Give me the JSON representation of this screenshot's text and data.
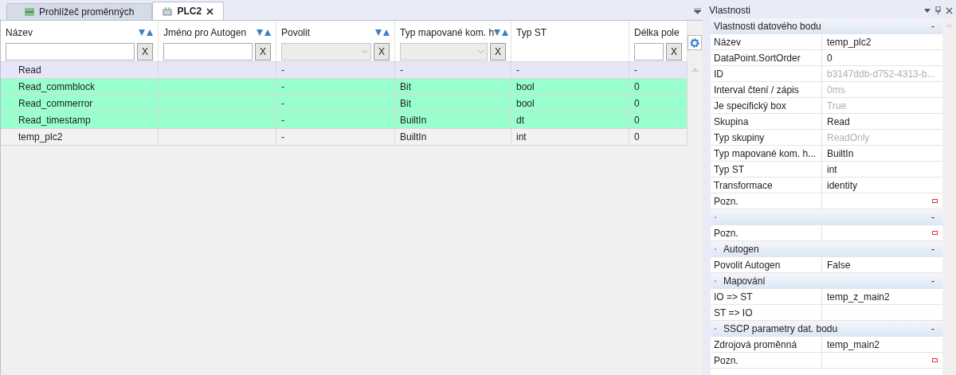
{
  "tabs": [
    {
      "label": "Prohlížeč proměnných",
      "selected": false,
      "closable": false
    },
    {
      "label": "PLC2",
      "selected": true,
      "closable": true
    }
  ],
  "grid": {
    "columns": [
      {
        "label": "Název",
        "sortable": true,
        "filter": {
          "kind": "text",
          "clear": "X"
        }
      },
      {
        "label": "Jméno pro Autogen",
        "sortable": true,
        "filter": {
          "kind": "text",
          "clear": "X"
        }
      },
      {
        "label": "Povolit",
        "sortable": true,
        "filter": {
          "kind": "select",
          "clear": "X"
        }
      },
      {
        "label": "Typ mapované kom. h",
        "sortable": true,
        "filter": {
          "kind": "select",
          "clear": "X"
        }
      },
      {
        "label": "Typ ST",
        "sortable": false
      },
      {
        "label": "Délka pole",
        "sortable": false,
        "filter": {
          "kind": "text",
          "clear": "X"
        }
      }
    ],
    "rows": [
      {
        "kind": "group",
        "cells": [
          "Read",
          "",
          "-",
          "-",
          "-",
          "-"
        ]
      },
      {
        "kind": "highlighted",
        "cells": [
          "Read_commblock",
          "",
          "-",
          "Bit",
          "bool",
          "0"
        ]
      },
      {
        "kind": "highlighted",
        "cells": [
          "Read_commerror",
          "",
          "-",
          "Bit",
          "bool",
          "0"
        ]
      },
      {
        "kind": "highlighted",
        "cells": [
          "Read_timestamp",
          "",
          "-",
          "BuiltIn",
          "dt",
          "0"
        ]
      },
      {
        "kind": "plain",
        "cells": [
          "temp_plc2",
          "",
          "-",
          "BuiltIn",
          "int",
          "0"
        ]
      }
    ]
  },
  "properties": {
    "title": "Vlastnosti",
    "sections": [
      {
        "bullet": false,
        "title": "Vlastnosti datového bodu",
        "collapse": "-",
        "rows": [
          {
            "name": "Název",
            "value": "temp_plc2",
            "disabled": false,
            "note": false
          },
          {
            "name": "DataPoint.SortOrder",
            "value": "0",
            "disabled": false,
            "note": false
          },
          {
            "name": "ID",
            "value": "b3147ddb-d752-4313-b...",
            "disabled": true,
            "note": false
          },
          {
            "name": "Interval čtení / zápis",
            "value": "0ms",
            "disabled": true,
            "note": false
          },
          {
            "name": "Je specifický box",
            "value": "True",
            "disabled": true,
            "note": false
          },
          {
            "name": "Skupina",
            "value": "Read",
            "disabled": false,
            "note": false
          },
          {
            "name": "Typ skupiny",
            "value": "ReadOnly",
            "disabled": true,
            "note": false
          },
          {
            "name": "Typ mapované kom. h...",
            "value": "BuiltIn",
            "disabled": false,
            "note": false
          },
          {
            "name": "Typ ST",
            "value": "int",
            "disabled": false,
            "note": false
          },
          {
            "name": "Transformace",
            "value": "identity",
            "disabled": false,
            "note": false
          },
          {
            "name": "Pozn.",
            "note": true
          }
        ]
      },
      {
        "bullet": true,
        "collapse": "-",
        "rows": [
          {
            "name": "Pozn.",
            "note": true
          }
        ]
      },
      {
        "bullet": true,
        "title": "Autogen",
        "collapse": "-",
        "rows": [
          {
            "name": "Povolit Autogen",
            "value": "False",
            "disabled": false,
            "note": false
          }
        ]
      },
      {
        "bullet": true,
        "title": "Mapování",
        "collapse": "-",
        "rows": [
          {
            "name": "IO => ST",
            "value": "temp_z_main2",
            "disabled": false,
            "note": false
          },
          {
            "name": "ST => IO",
            "note": false
          }
        ]
      },
      {
        "bullet": true,
        "title": "SSCP parametry dat. bodu",
        "collapse": "-",
        "rows": [
          {
            "name": "Zdrojová proměnná",
            "value": "temp_main2",
            "disabled": false,
            "note": false
          },
          {
            "name": "Pozn.",
            "note": true
          }
        ]
      }
    ]
  }
}
